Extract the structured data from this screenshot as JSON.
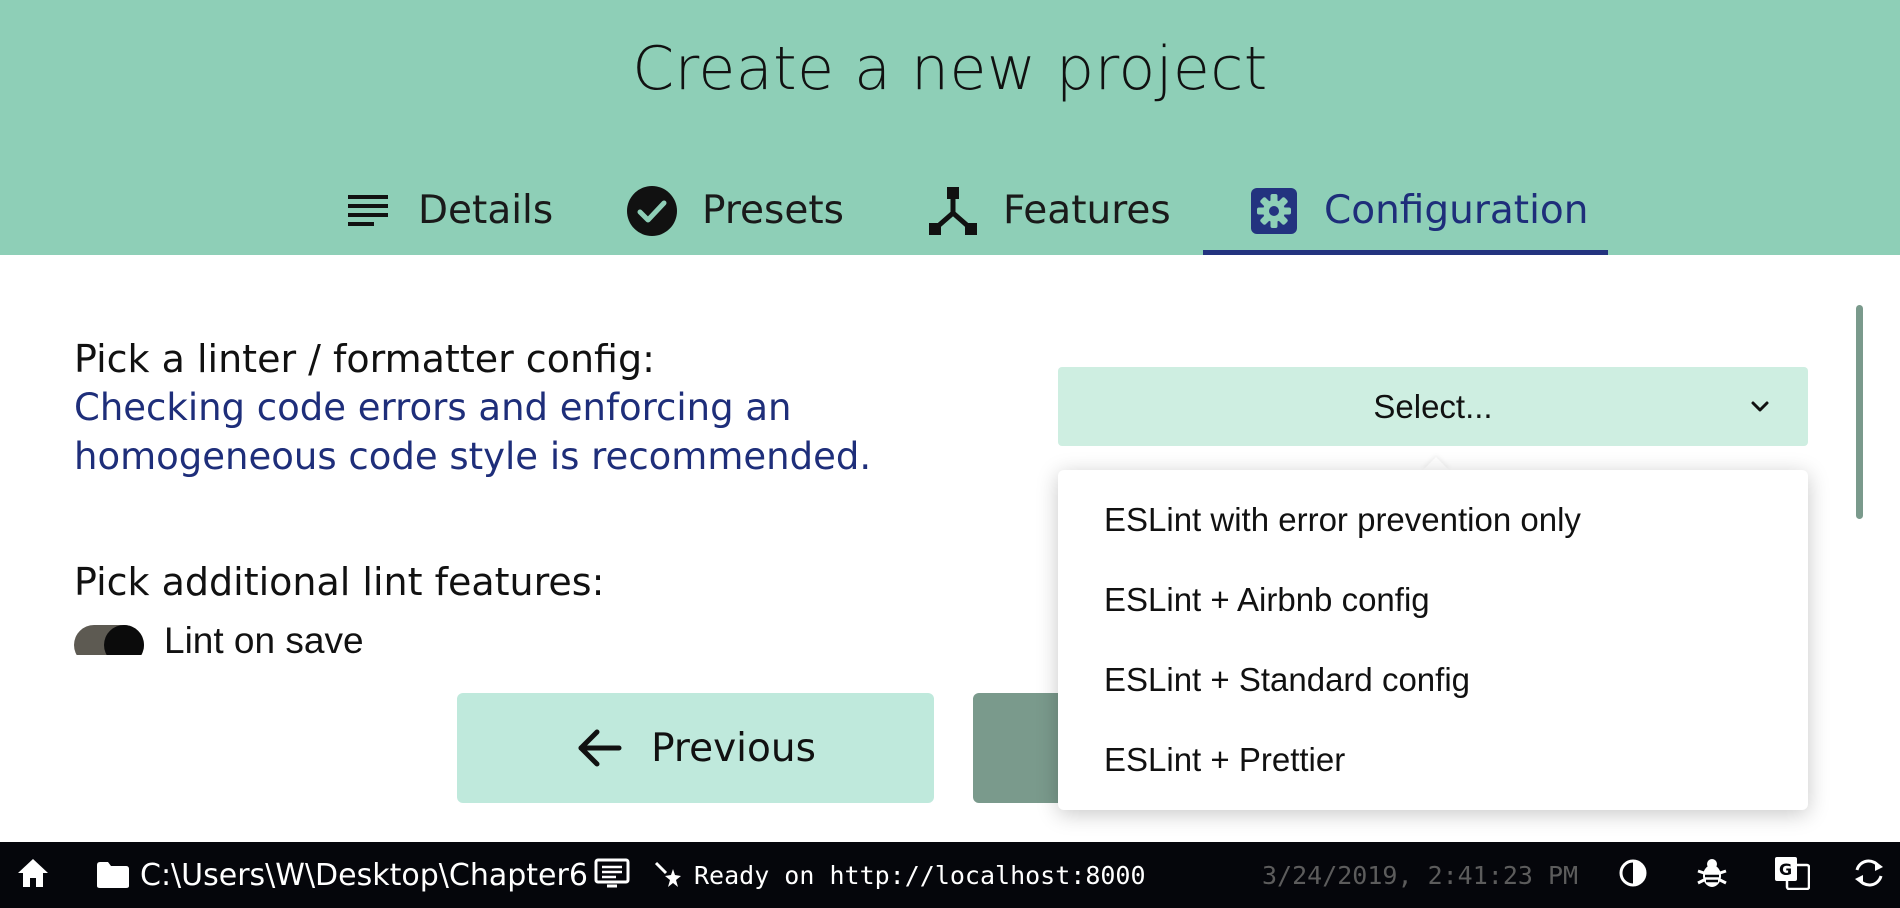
{
  "header": {
    "title": "Create a new project",
    "tabs": [
      {
        "label": "Details",
        "icon": "list-icon"
      },
      {
        "label": "Presets",
        "icon": "check-circle-icon"
      },
      {
        "label": "Features",
        "icon": "fork-icon"
      },
      {
        "label": "Configuration",
        "icon": "gear-icon"
      }
    ],
    "active_tab": "Configuration"
  },
  "content": {
    "linter_label": "Pick a linter / formatter config:",
    "linter_desc_line1": "Checking code errors and enforcing an",
    "linter_desc_line2": "homogeneous code style is recommended.",
    "select_value": "Select...",
    "lint_features_label": "Pick additional lint features:",
    "lint_on_save_label": "Lint on save"
  },
  "dropdown": {
    "options": [
      "ESLint with error prevention only",
      "ESLint + Airbnb config",
      "ESLint + Standard config",
      "ESLint + Prettier"
    ]
  },
  "buttons": {
    "previous_label": "Previous"
  },
  "statusbar": {
    "path": "C:\\Users\\W\\Desktop\\Chapter6",
    "status": "Ready on http://localhost:8000",
    "datetime": "3/24/2019, 2:41:23 PM"
  },
  "colors": {
    "header_bg": "#8ecfb7",
    "accent": "#1e2e7a",
    "select_bg": "#ceeee1",
    "prev_button_bg": "#bfe9dc",
    "next_button_bg": "#7a9a8c",
    "statusbar_bg": "#05060b"
  }
}
